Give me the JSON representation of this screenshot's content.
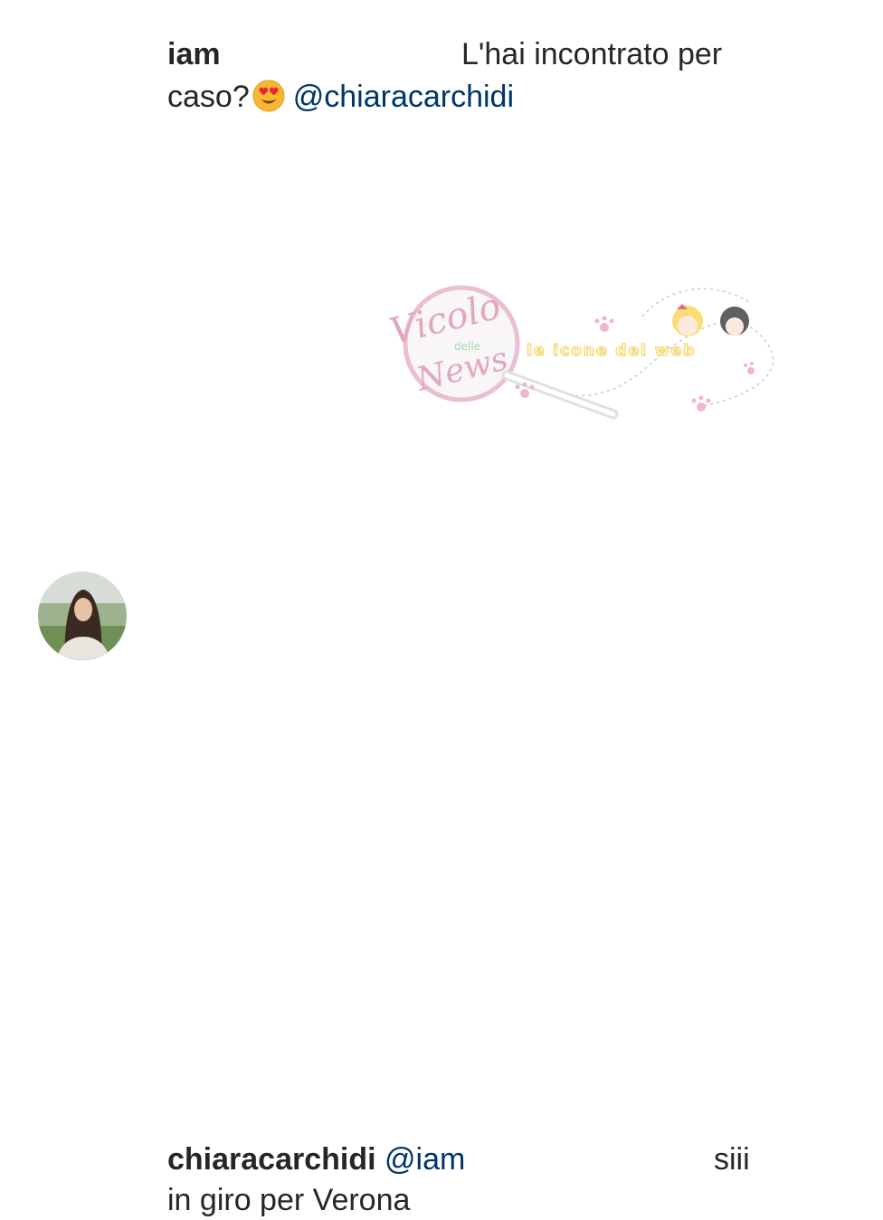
{
  "comments": [
    {
      "username": "iam",
      "text_line1": "L'hai incontrato per",
      "text_line2_prefix": "caso?",
      "emoji": "heart-eyes-emoji",
      "mention": "@chiaracarchidi"
    },
    {
      "username": "chiaracarchidi",
      "mention": "@iam",
      "text_line1_end": "siii",
      "text_line2": "in giro per Verona"
    }
  ],
  "watermark": {
    "brand_line1": "Vicolo",
    "brand_small": "delle",
    "brand_line2": "News",
    "tagline": "le icone del web"
  },
  "colors": {
    "text": "#262626",
    "mention": "#003569",
    "watermark_pink": "#d98aa6",
    "watermark_yellow": "#f2cf4a"
  }
}
